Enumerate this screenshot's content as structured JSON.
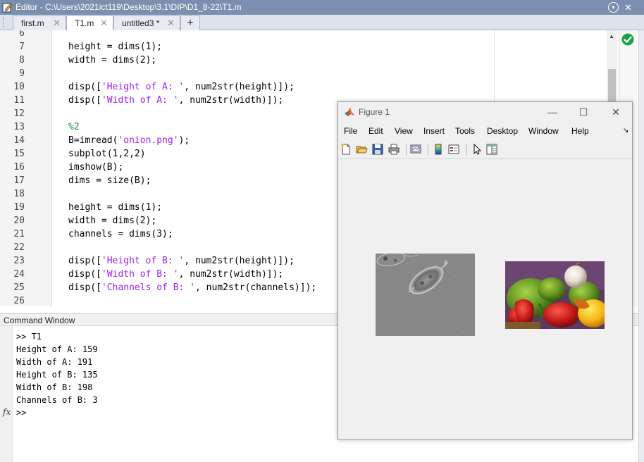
{
  "editor": {
    "title": "Editor - C:\\Users\\2021ict119\\Desktop\\3.1\\DIP\\D1_8-22\\T1.m",
    "menu_glyph": "▾",
    "close_glyph": "✕",
    "tabs": [
      {
        "label": "first.m",
        "close": "✕",
        "active": false
      },
      {
        "label": "T1.m",
        "close": "✕",
        "active": true
      },
      {
        "label": "untitled3 *",
        "close": "✕",
        "active": false
      }
    ],
    "add_tab": "+",
    "scroll_up": "▲",
    "lines": [
      {
        "num": "6",
        "code": ""
      },
      {
        "num": "7",
        "code": "height = dims(1);"
      },
      {
        "num": "8",
        "code": "width = dims(2);"
      },
      {
        "num": "9",
        "code": ""
      },
      {
        "num": "10",
        "pre": "disp([",
        "str": "'Height of A: '",
        "post": ", num2str(height)]);"
      },
      {
        "num": "11",
        "pre": "disp([",
        "str": "'Width of A: '",
        "post": ", num2str(width)]);"
      },
      {
        "num": "12",
        "code": ""
      },
      {
        "num": "13",
        "comment": "%2"
      },
      {
        "num": "14",
        "pre": "B=imread(",
        "str": "'onion.png'",
        "post": ");"
      },
      {
        "num": "15",
        "code": "subplot(1,2,2)"
      },
      {
        "num": "16",
        "code": "imshow(B);"
      },
      {
        "num": "17",
        "code": "dims = size(B);"
      },
      {
        "num": "18",
        "code": ""
      },
      {
        "num": "19",
        "code": "height = dims(1);"
      },
      {
        "num": "20",
        "code": "width = dims(2);"
      },
      {
        "num": "21",
        "code": "channels = dims(3);"
      },
      {
        "num": "22",
        "code": ""
      },
      {
        "num": "23",
        "pre": "disp([",
        "str": "'Height of B: '",
        "post": ", num2str(height)]);"
      },
      {
        "num": "24",
        "pre": "disp([",
        "str": "'Width of B: '",
        "post": ", num2str(width)]);"
      },
      {
        "num": "25",
        "pre": "disp([",
        "str": "'Channels of B: '",
        "post": ", num2str(channels)]);"
      },
      {
        "num": "26",
        "code": ""
      }
    ]
  },
  "command_window": {
    "title": "Command Window",
    "lines": [
      ">> T1",
      "Height of A: 159",
      "Width of A: 191",
      "Height of B: 135",
      "Width of B: 198",
      "Channels of B: 3",
      ">> "
    ],
    "fx_label": "fx"
  },
  "figure": {
    "title": "Figure 1",
    "min_glyph": "—",
    "max_glyph": "☐",
    "close_glyph": "✕",
    "menus": [
      "File",
      "Edit",
      "View",
      "Insert",
      "Tools",
      "Desktop",
      "Window",
      "Help"
    ],
    "menu_more": "↘",
    "toolbar_icons": [
      "new-figure-icon",
      "open-file-icon",
      "save-icon",
      "print-icon",
      "link-plot-icon",
      "colorbar-icon",
      "legend-icon",
      "edit-plot-icon",
      "property-inspector-icon"
    ]
  },
  "colors": {
    "titlebar": "#7b90b0",
    "string": "#a020f0",
    "comment": "#228b22",
    "ok_green": "#1aa24a"
  }
}
